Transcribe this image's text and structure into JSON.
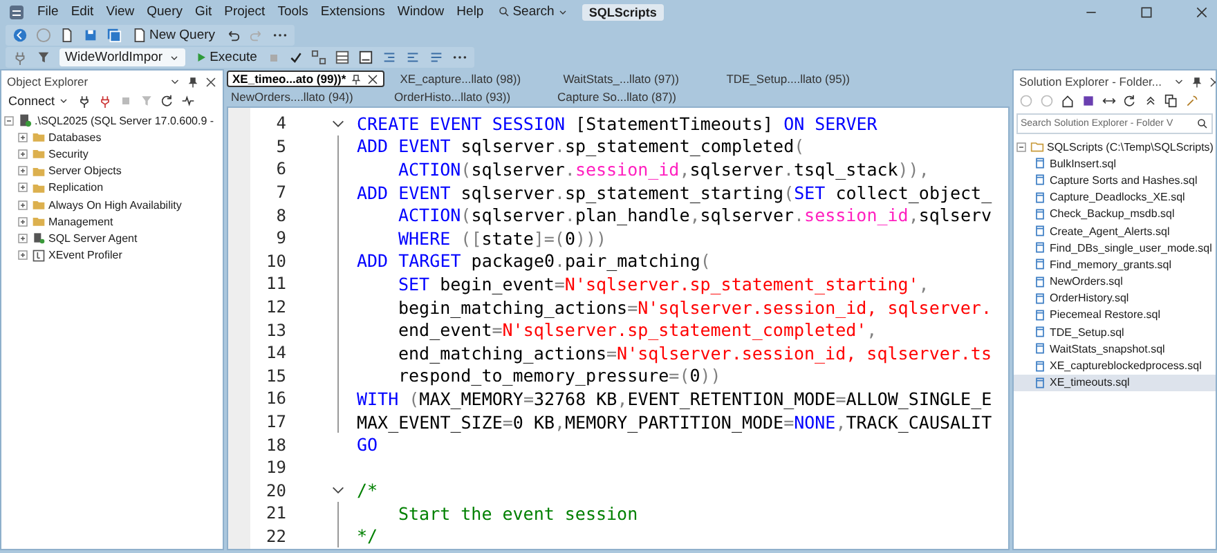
{
  "menu_bar": {
    "items": [
      "File",
      "Edit",
      "View",
      "Query",
      "Git",
      "Project",
      "Tools",
      "Extensions",
      "Window",
      "Help"
    ],
    "search": "Search",
    "solution_name": "SQLScripts"
  },
  "toolbar": {
    "new_query": "New Query"
  },
  "query_toolbar": {
    "database": "WideWorldImpor",
    "execute": "Execute"
  },
  "object_explorer": {
    "title": "Object Explorer",
    "connect": "Connect",
    "root": {
      "label": ".\\SQL2025 (SQL Server 17.0.600.9 -",
      "expanded": true,
      "children": [
        {
          "label": "Databases",
          "kind": "folder",
          "expanded": false
        },
        {
          "label": "Security",
          "kind": "folder",
          "expanded": false
        },
        {
          "label": "Server Objects",
          "kind": "folder",
          "expanded": false
        },
        {
          "label": "Replication",
          "kind": "folder",
          "expanded": false
        },
        {
          "label": "Always On High Availability",
          "kind": "folder",
          "expanded": false
        },
        {
          "label": "Management",
          "kind": "folder",
          "expanded": false
        },
        {
          "label": "SQL Server Agent",
          "kind": "agent",
          "expanded": false
        },
        {
          "label": "XEvent Profiler",
          "kind": "profiler",
          "expanded": false
        }
      ]
    }
  },
  "tab_rows": [
    {
      "tabs": [
        {
          "label": "XE_timeo...ato (99))*",
          "selected": true
        },
        {
          "label": "XE_capture...llato (98))",
          "selected": false
        },
        {
          "label": "WaitStats_...llato (97))",
          "selected": false
        },
        {
          "label": "TDE_Setup....llato (95))",
          "selected": false
        }
      ]
    },
    {
      "tabs": [
        {
          "label": "NewOrders....llato (94))",
          "selected": false
        },
        {
          "label": "OrderHisto...llato (93))",
          "selected": false
        },
        {
          "label": "Capture So...llato (87))",
          "selected": false
        }
      ]
    }
  ],
  "editor": {
    "lines": [
      {
        "number": "4",
        "foldable": true,
        "in_block": false,
        "indented": false,
        "tokens": [
          {
            "kind": "keyword",
            "text": "CREATE EVENT SESSION"
          },
          {
            "kind": "plain",
            "text": " [StatementTimeouts] "
          },
          {
            "kind": "keyword",
            "text": "ON SERVER"
          }
        ]
      },
      {
        "number": "5",
        "foldable": false,
        "in_block": true,
        "indented": false,
        "tokens": [
          {
            "kind": "keyword",
            "text": "ADD EVENT"
          },
          {
            "kind": "plain",
            "text": " sqlserver"
          },
          {
            "kind": "operator",
            "text": "."
          },
          {
            "kind": "plain",
            "text": "sp_statement_completed"
          },
          {
            "kind": "operator",
            "text": "("
          }
        ]
      },
      {
        "number": "6",
        "foldable": false,
        "in_block": true,
        "indented": true,
        "tokens": [
          {
            "kind": "keyword",
            "text": "ACTION"
          },
          {
            "kind": "operator",
            "text": "("
          },
          {
            "kind": "plain",
            "text": "sqlserver"
          },
          {
            "kind": "operator",
            "text": "."
          },
          {
            "kind": "system",
            "text": "session_id"
          },
          {
            "kind": "operator",
            "text": ","
          },
          {
            "kind": "plain",
            "text": "sqlserver"
          },
          {
            "kind": "operator",
            "text": "."
          },
          {
            "kind": "plain",
            "text": "tsql_stack"
          },
          {
            "kind": "operator",
            "text": ")),"
          }
        ]
      },
      {
        "number": "7",
        "foldable": false,
        "in_block": true,
        "indented": false,
        "tokens": [
          {
            "kind": "keyword",
            "text": "ADD EVENT"
          },
          {
            "kind": "plain",
            "text": " sqlserver"
          },
          {
            "kind": "operator",
            "text": "."
          },
          {
            "kind": "plain",
            "text": "sp_statement_starting"
          },
          {
            "kind": "operator",
            "text": "("
          },
          {
            "kind": "keyword",
            "text": "SET"
          },
          {
            "kind": "plain",
            "text": " collect_object_"
          }
        ]
      },
      {
        "number": "8",
        "foldable": false,
        "in_block": true,
        "indented": true,
        "tokens": [
          {
            "kind": "keyword",
            "text": "ACTION"
          },
          {
            "kind": "operator",
            "text": "("
          },
          {
            "kind": "plain",
            "text": "sqlserver"
          },
          {
            "kind": "operator",
            "text": "."
          },
          {
            "kind": "plain",
            "text": "plan_handle"
          },
          {
            "kind": "operator",
            "text": ","
          },
          {
            "kind": "plain",
            "text": "sqlserver"
          },
          {
            "kind": "operator",
            "text": "."
          },
          {
            "kind": "system",
            "text": "session_id"
          },
          {
            "kind": "operator",
            "text": ","
          },
          {
            "kind": "plain",
            "text": "sqlserv"
          }
        ]
      },
      {
        "number": "9",
        "foldable": false,
        "in_block": true,
        "indented": true,
        "tokens": [
          {
            "kind": "keyword",
            "text": "WHERE"
          },
          {
            "kind": "operator",
            "text": " (["
          },
          {
            "kind": "plain",
            "text": "state"
          },
          {
            "kind": "operator",
            "text": "]=("
          },
          {
            "kind": "plain",
            "text": "0"
          },
          {
            "kind": "operator",
            "text": ")))"
          }
        ]
      },
      {
        "number": "10",
        "foldable": false,
        "in_block": true,
        "indented": false,
        "tokens": [
          {
            "kind": "keyword",
            "text": "ADD TARGET"
          },
          {
            "kind": "plain",
            "text": " package0"
          },
          {
            "kind": "operator",
            "text": "."
          },
          {
            "kind": "plain",
            "text": "pair_matching"
          },
          {
            "kind": "operator",
            "text": "("
          }
        ]
      },
      {
        "number": "11",
        "foldable": false,
        "in_block": true,
        "indented": true,
        "tokens": [
          {
            "kind": "keyword",
            "text": "SET"
          },
          {
            "kind": "plain",
            "text": " begin_event"
          },
          {
            "kind": "operator",
            "text": "="
          },
          {
            "kind": "string",
            "text": "N'sqlserver.sp_statement_starting'"
          },
          {
            "kind": "operator",
            "text": ","
          }
        ]
      },
      {
        "number": "12",
        "foldable": false,
        "in_block": true,
        "indented": true,
        "tokens": [
          {
            "kind": "plain",
            "text": "begin_matching_actions"
          },
          {
            "kind": "operator",
            "text": "="
          },
          {
            "kind": "string",
            "text": "N'sqlserver.session_id, sqlserver."
          }
        ]
      },
      {
        "number": "13",
        "foldable": false,
        "in_block": true,
        "indented": true,
        "tokens": [
          {
            "kind": "plain",
            "text": "end_event"
          },
          {
            "kind": "operator",
            "text": "="
          },
          {
            "kind": "string",
            "text": "N'sqlserver.sp_statement_completed'"
          },
          {
            "kind": "operator",
            "text": ","
          }
        ]
      },
      {
        "number": "14",
        "foldable": false,
        "in_block": true,
        "indented": true,
        "tokens": [
          {
            "kind": "plain",
            "text": "end_matching_actions"
          },
          {
            "kind": "operator",
            "text": "="
          },
          {
            "kind": "string",
            "text": "N'sqlserver.session_id, sqlserver.ts"
          }
        ]
      },
      {
        "number": "15",
        "foldable": false,
        "in_block": true,
        "indented": true,
        "tokens": [
          {
            "kind": "plain",
            "text": "respond_to_memory_pressure"
          },
          {
            "kind": "operator",
            "text": "=("
          },
          {
            "kind": "plain",
            "text": "0"
          },
          {
            "kind": "operator",
            "text": "))"
          }
        ]
      },
      {
        "number": "16",
        "foldable": false,
        "in_block": true,
        "indented": false,
        "tokens": [
          {
            "kind": "keyword",
            "text": "WITH"
          },
          {
            "kind": "operator",
            "text": " ("
          },
          {
            "kind": "plain",
            "text": "MAX_MEMORY"
          },
          {
            "kind": "operator",
            "text": "="
          },
          {
            "kind": "plain",
            "text": "32768 KB"
          },
          {
            "kind": "operator",
            "text": ","
          },
          {
            "kind": "plain",
            "text": "EVENT_RETENTION_MODE"
          },
          {
            "kind": "operator",
            "text": "="
          },
          {
            "kind": "plain",
            "text": "ALLOW_SINGLE_E"
          }
        ]
      },
      {
        "number": "17",
        "foldable": false,
        "in_block": true,
        "indented": false,
        "tokens": [
          {
            "kind": "plain",
            "text": "MAX_EVENT_SIZE"
          },
          {
            "kind": "operator",
            "text": "="
          },
          {
            "kind": "plain",
            "text": "0 KB"
          },
          {
            "kind": "operator",
            "text": ","
          },
          {
            "kind": "plain",
            "text": "MEMORY_PARTITION_MODE"
          },
          {
            "kind": "operator",
            "text": "="
          },
          {
            "kind": "keyword",
            "text": "NONE"
          },
          {
            "kind": "operator",
            "text": ","
          },
          {
            "kind": "plain",
            "text": "TRACK_CAUSALIT"
          }
        ]
      },
      {
        "number": "18",
        "foldable": false,
        "in_block": false,
        "indented": false,
        "tokens": [
          {
            "kind": "keyword",
            "text": "GO"
          }
        ]
      },
      {
        "number": "19",
        "foldable": false,
        "in_block": false,
        "indented": false
      },
      {
        "number": "20",
        "foldable": true,
        "in_block": false,
        "indented": false,
        "tokens": [
          {
            "kind": "comment",
            "text": "/*"
          }
        ]
      },
      {
        "number": "21",
        "foldable": false,
        "in_block": true,
        "indented": true,
        "tokens": [
          {
            "kind": "comment",
            "text": "Start the event session"
          }
        ]
      },
      {
        "number": "22",
        "foldable": false,
        "in_block": true,
        "indented": false,
        "tokens": [
          {
            "kind": "comment",
            "text": "*/"
          }
        ]
      }
    ]
  },
  "solution_explorer": {
    "title": "Solution Explorer - Folder...",
    "search": {
      "placeholder": "Search Solution Explorer - Folder V"
    },
    "root": {
      "label": "SQLScripts (C:\\Temp\\SQLScripts)",
      "expanded": true,
      "children": [
        {
          "label": "BulkInsert.sql",
          "selected": false
        },
        {
          "label": "Capture Sorts and Hashes.sql",
          "selected": false
        },
        {
          "label": "Capture_Deadlocks_XE.sql",
          "selected": false
        },
        {
          "label": "Check_Backup_msdb.sql",
          "selected": false
        },
        {
          "label": "Create_Agent_Alerts.sql",
          "selected": false
        },
        {
          "label": "Find_DBs_single_user_mode.sql",
          "selected": false
        },
        {
          "label": "Find_memory_grants.sql",
          "selected": false
        },
        {
          "label": "NewOrders.sql",
          "selected": false
        },
        {
          "label": "OrderHistory.sql",
          "selected": false
        },
        {
          "label": "Piecemeal Restore.sql",
          "selected": false
        },
        {
          "label": "TDE_Setup.sql",
          "selected": false
        },
        {
          "label": "WaitStats_snapshot.sql",
          "selected": false
        },
        {
          "label": "XE_captureblockedprocess.sql",
          "selected": false
        },
        {
          "label": "XE_timeouts.sql",
          "selected": true
        }
      ]
    }
  }
}
